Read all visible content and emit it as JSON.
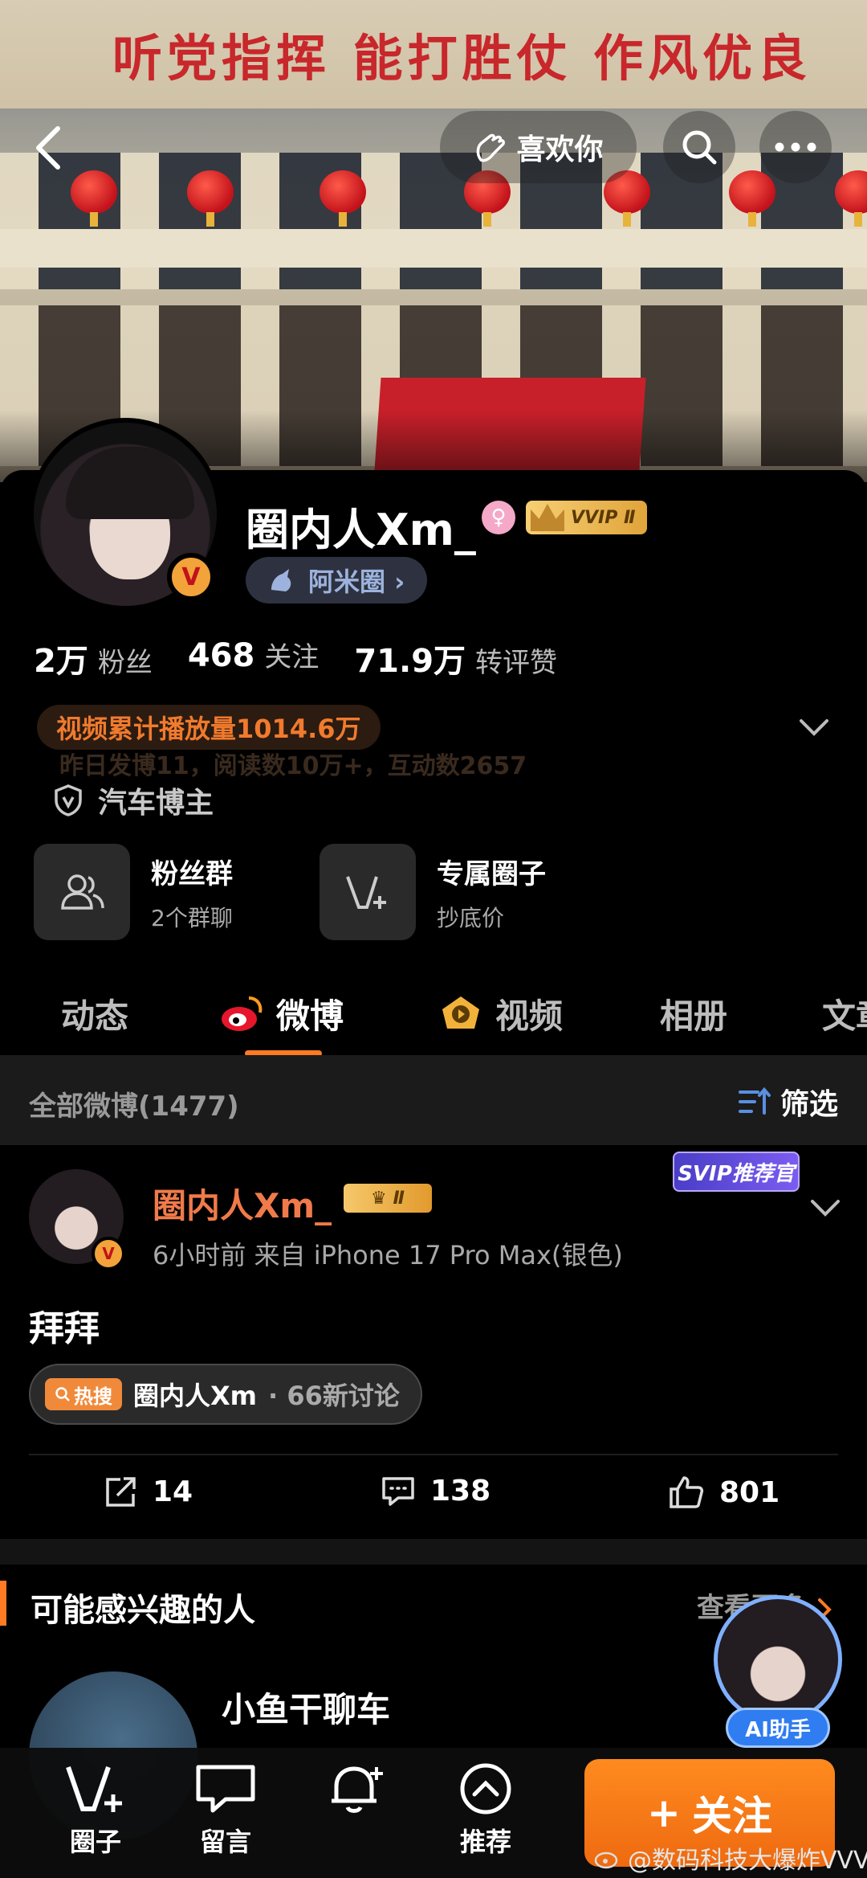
{
  "hero": {
    "slogan": "听党指挥  能打胜仗  作风优良",
    "like_label": "喜欢你"
  },
  "profile": {
    "name": "圈内人Xm_",
    "vip_label": "VVIP Ⅱ",
    "verified_mark": "V",
    "circle_tag": "阿米圈 ›",
    "stats": [
      {
        "value": "2万",
        "label": "粉丝"
      },
      {
        "value": "468",
        "label": "关注"
      },
      {
        "value": "71.9万",
        "label": "转评赞"
      }
    ],
    "video_stat": "视频累计播放量1014.6万",
    "yesterday": "昨日发博11，阅读数10万+，互动数2657",
    "auth": "汽车博主",
    "features": [
      {
        "title": "粉丝群",
        "subtitle": "2个群聊"
      },
      {
        "title": "专属圈子",
        "subtitle": "抄底价"
      }
    ],
    "tabs": [
      "动态",
      "微博",
      "视频",
      "相册",
      "文章"
    ]
  },
  "filter": {
    "count": "全部微博(1477)",
    "screen": "筛选"
  },
  "post": {
    "author": "圈内人Xm_",
    "level": "Ⅱ",
    "time_source": "6小时前  来自 iPhone 17 Pro Max(银色)",
    "svip_badge": "SVIP推荐官",
    "text": "拜拜",
    "hot_tag": "热搜",
    "hot_title": "圈内人Xm",
    "hot_meta": "· 66新讨论",
    "reposts": "14",
    "comments": "138",
    "likes": "801"
  },
  "suggestions": {
    "title": "可能感兴趣的人",
    "more": "查看更多",
    "first_name": "小鱼干聊车"
  },
  "ai_assistant": "AI助手",
  "bottom_bar": {
    "items": [
      "圈子",
      "留言",
      "",
      "推荐"
    ],
    "follow": "关注"
  },
  "watermark": "@数码科技大爆炸VVV",
  "colors": {
    "accent": "#ff7a22",
    "name_orange": "#f07a4a",
    "ai_blue": "#2f7df0"
  }
}
